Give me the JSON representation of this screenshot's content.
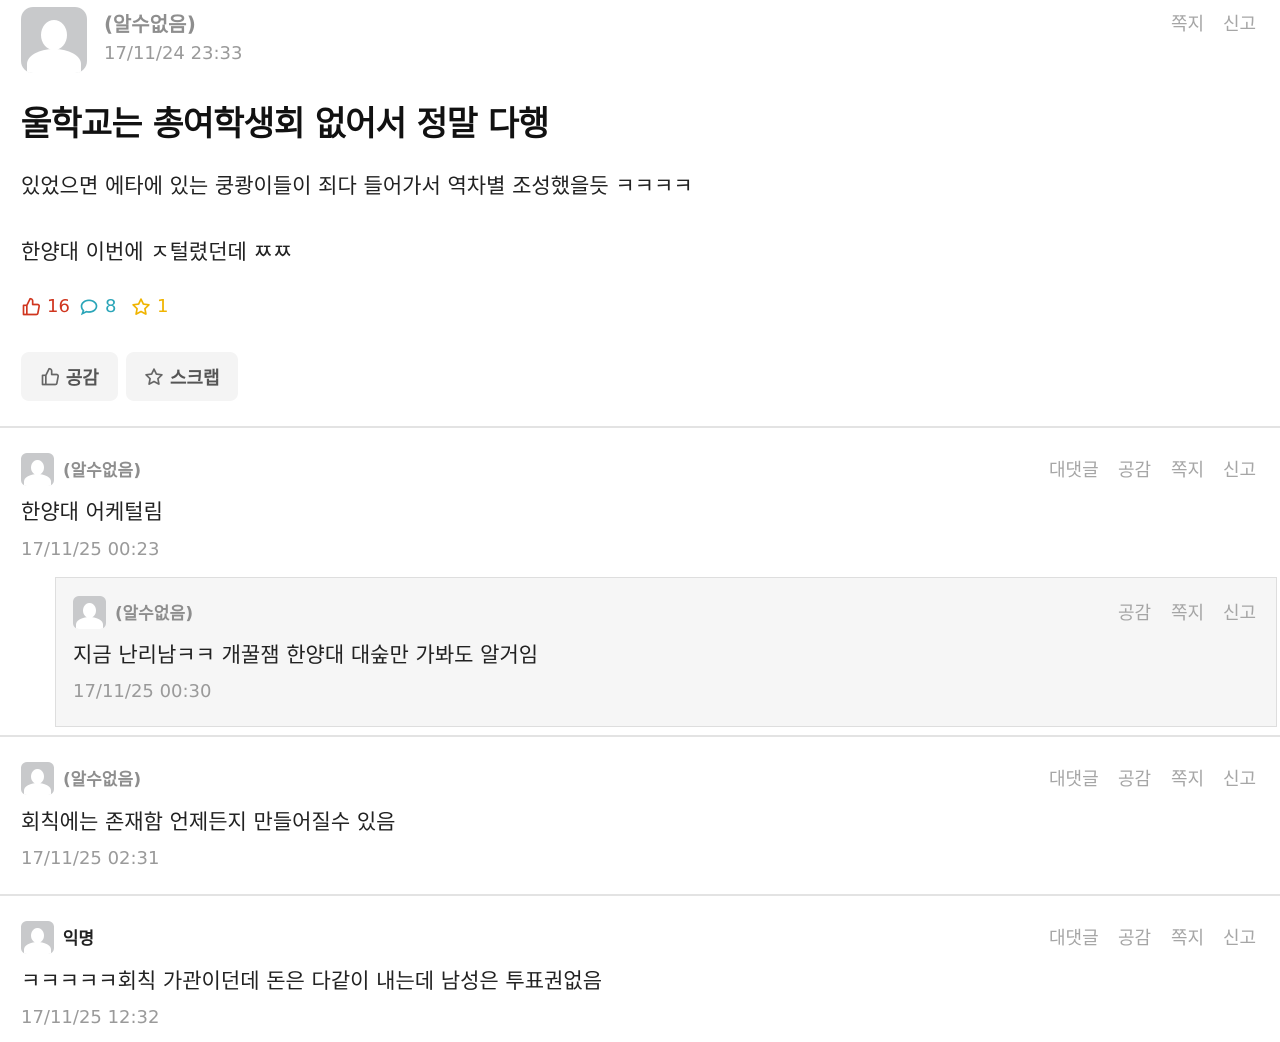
{
  "post": {
    "author": "(알수없음)",
    "time": "17/11/24 23:33",
    "actions": {
      "message": "쪽지",
      "report": "신고"
    },
    "title": "울학교는 총여학생회 없어서 정말 다행",
    "body_lines": [
      "있었으면 에타에 있는 쿵쾅이들이 죄다 들어가서 역차별 조성했을듯 ㅋㅋㅋㅋ",
      "한양대 이번에 ㅈ털렸던데 ㅉㅉ"
    ],
    "stats": {
      "likes": "16",
      "comments": "8",
      "scraps": "1"
    },
    "buttons": {
      "like": "공감",
      "scrap": "스크랩"
    },
    "colors": {
      "likes": "#d0361f",
      "comments": "#2aa5b8",
      "scraps": "#f0b400"
    }
  },
  "comment_actions": {
    "reply": "대댓글",
    "like": "공감",
    "message": "쪽지",
    "report": "신고"
  },
  "comments": [
    {
      "author": "(알수없음)",
      "text": "한양대 어케털림",
      "time": "17/11/25 00:23"
    },
    {
      "author": "(알수없음)",
      "text": "지금 난리남ㅋㅋ 개꿀잼 한양대 대숲만 가봐도 알거임",
      "time": "17/11/25 00:30"
    },
    {
      "author": "(알수없음)",
      "text": "회칙에는 존재함 언제든지 만들어질수 있음",
      "time": "17/11/25 02:31"
    },
    {
      "author": "익명",
      "text": "ㅋㅋㅋㅋㅋ회칙 가관이던데 돈은 다같이 내는데 남성은 투표권없음",
      "time": "17/11/25 12:32"
    }
  ]
}
